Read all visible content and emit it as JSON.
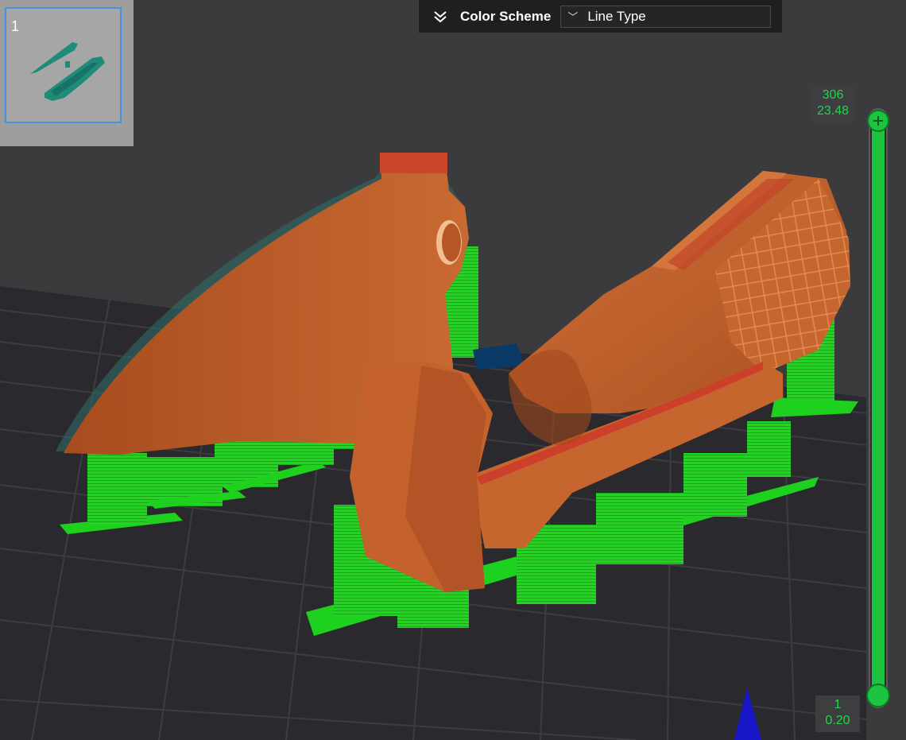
{
  "plate": {
    "index": "1"
  },
  "color_scheme": {
    "label": "Color Scheme",
    "selected": "Line Type"
  },
  "layer_slider": {
    "top": {
      "layer": "306",
      "height": "23.48"
    },
    "bottom": {
      "layer": "1",
      "height": "0.20"
    }
  },
  "colors": {
    "background": "#3a3a3d",
    "bed_grid": "#2a2a2e",
    "wall": "#c0602a",
    "support": "#22dd22",
    "accent": "#1cc43f",
    "selection": "#4a90e2"
  },
  "icons": {
    "collapse": "double-chevron-down-icon",
    "dropdown": "chevron-down-icon",
    "axis": "z-axis-arrow-icon"
  }
}
